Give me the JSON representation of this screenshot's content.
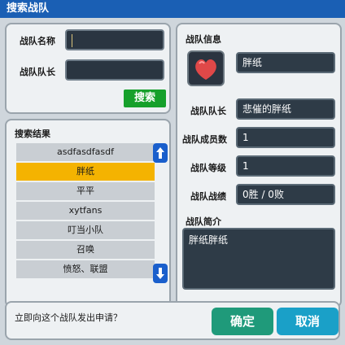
{
  "window": {
    "title": "搜索战队"
  },
  "search": {
    "name_label": "战队名称",
    "name_value": "",
    "leader_label": "战队队长",
    "leader_value": "",
    "search_button": "搜索"
  },
  "results": {
    "title": "搜索结果",
    "items": [
      "asdfasdfasdf",
      "胖纸",
      "平平",
      "xytfans",
      "叮当小队",
      "召唤",
      "愤怒、联盟"
    ],
    "selected_index": 1
  },
  "info": {
    "title": "战队信息",
    "team_name": "胖纸",
    "leader_label": "战队队长",
    "leader_value": "悲催的胖纸",
    "members_label": "战队成员数",
    "members_value": "1",
    "level_label": "战队等级",
    "level_value": "1",
    "record_label": "战队战绩",
    "record_value": "0胜 / 0败",
    "intro_label": "战队简介",
    "intro_value": "胖纸胖纸"
  },
  "footer": {
    "prompt": "立即向这个战队发出申请？",
    "confirm": "确定",
    "cancel": "取消"
  },
  "colors": {
    "titlebar": "#1a5fb4",
    "selected": "#f4b301",
    "search_button": "#16a02b",
    "confirm": "#1f9a7a",
    "cancel": "#1aa0c8"
  }
}
